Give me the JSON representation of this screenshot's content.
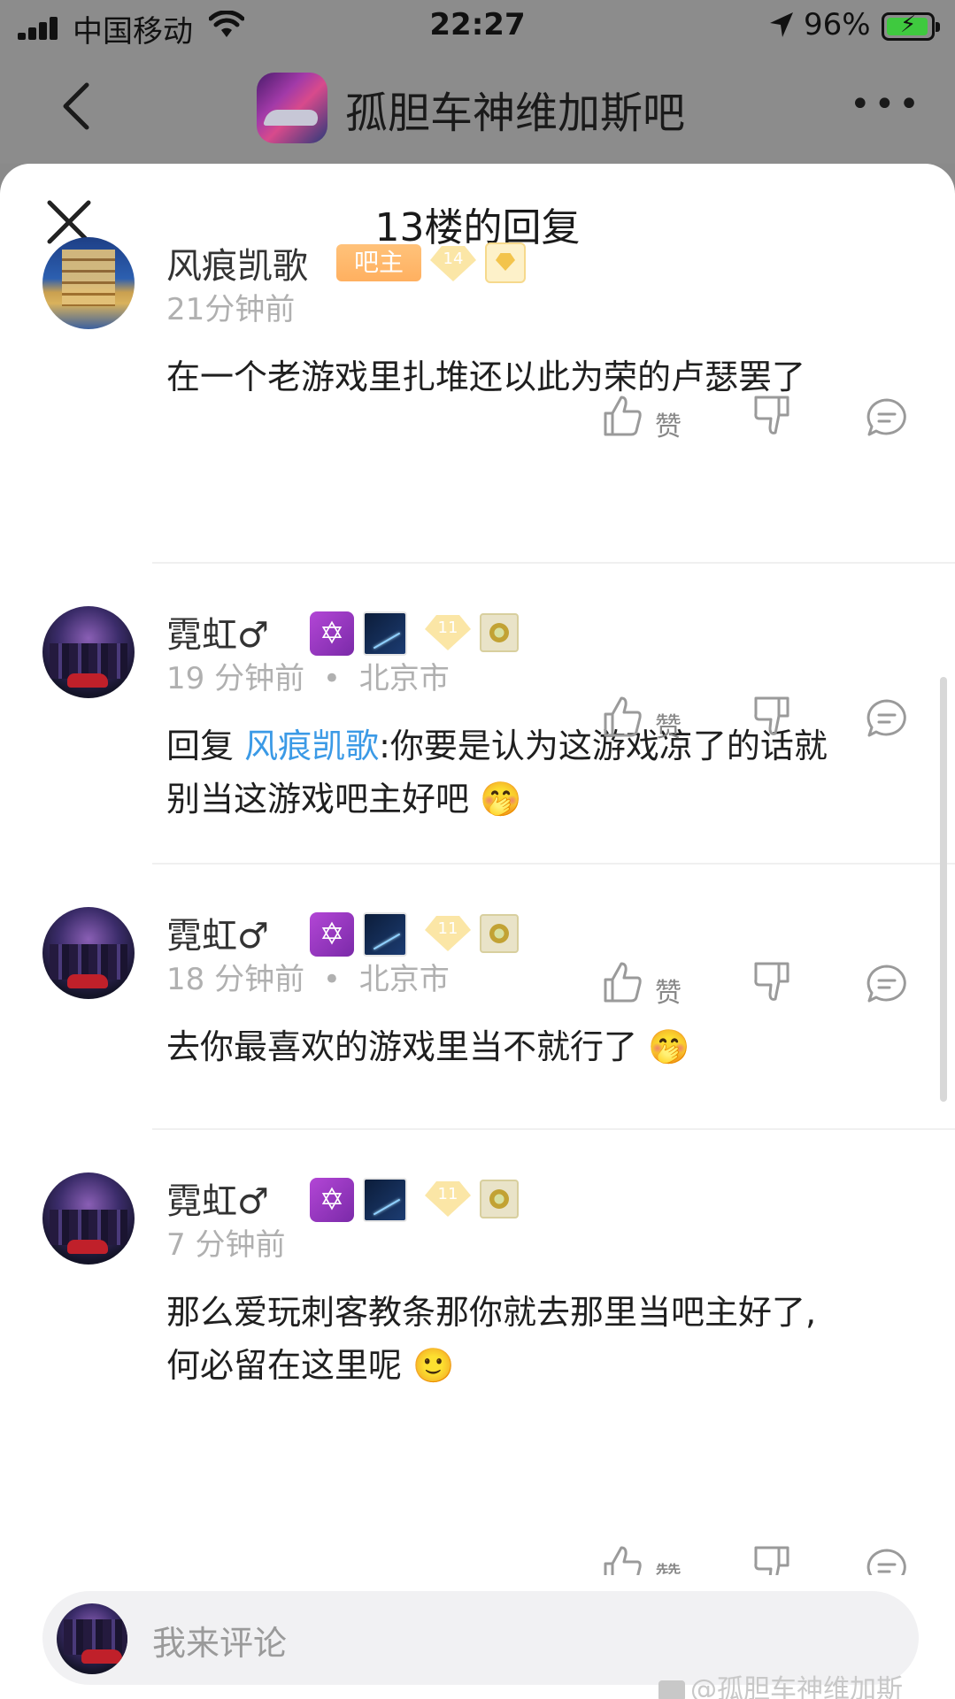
{
  "status_bar": {
    "carrier": "中国移动",
    "time": "22:27",
    "battery_percent": "96%",
    "icons": [
      "signal-icon",
      "wifi-icon",
      "location-arrow-icon",
      "battery-charging-icon"
    ]
  },
  "header": {
    "forum_name": "孤胆车神维加斯吧",
    "more_label": "•••"
  },
  "sheet": {
    "title": "13楼的回复",
    "comments": [
      {
        "username": "风痕凯歌",
        "role_badge": "吧主",
        "level": "14",
        "time": "21分钟前",
        "location": "",
        "text": "在一个老游戏里扎堆还以此为荣的卢瑟罢了",
        "like_label": "赞"
      },
      {
        "username": "霓虹♂",
        "level": "11",
        "time": "19 分钟前",
        "location": "北京市",
        "reply_prefix": "回复",
        "reply_to": "风痕凯歌",
        "text_line1": ":你要是认为这游戏凉了的话就",
        "text_line2": "别当这游戏吧主好吧 🤭",
        "like_label": "赞"
      },
      {
        "username": "霓虹♂",
        "level": "11",
        "time": "18 分钟前",
        "location": "北京市",
        "text": "去你最喜欢的游戏里当不就行了 🤭",
        "like_label": "赞"
      },
      {
        "username": "霓虹♂",
        "level": "11",
        "time": "7 分钟前",
        "location": "",
        "text_line1": "那么爱玩刺客教条那你就去那里当吧主好了,",
        "text_line2": "何必留在这里呢 🙂",
        "like_label": "赞"
      }
    ],
    "location_separator": "•"
  },
  "bottom_bar": {
    "placeholder": "我来评论",
    "watermark": "@孤胆车神维加斯"
  }
}
